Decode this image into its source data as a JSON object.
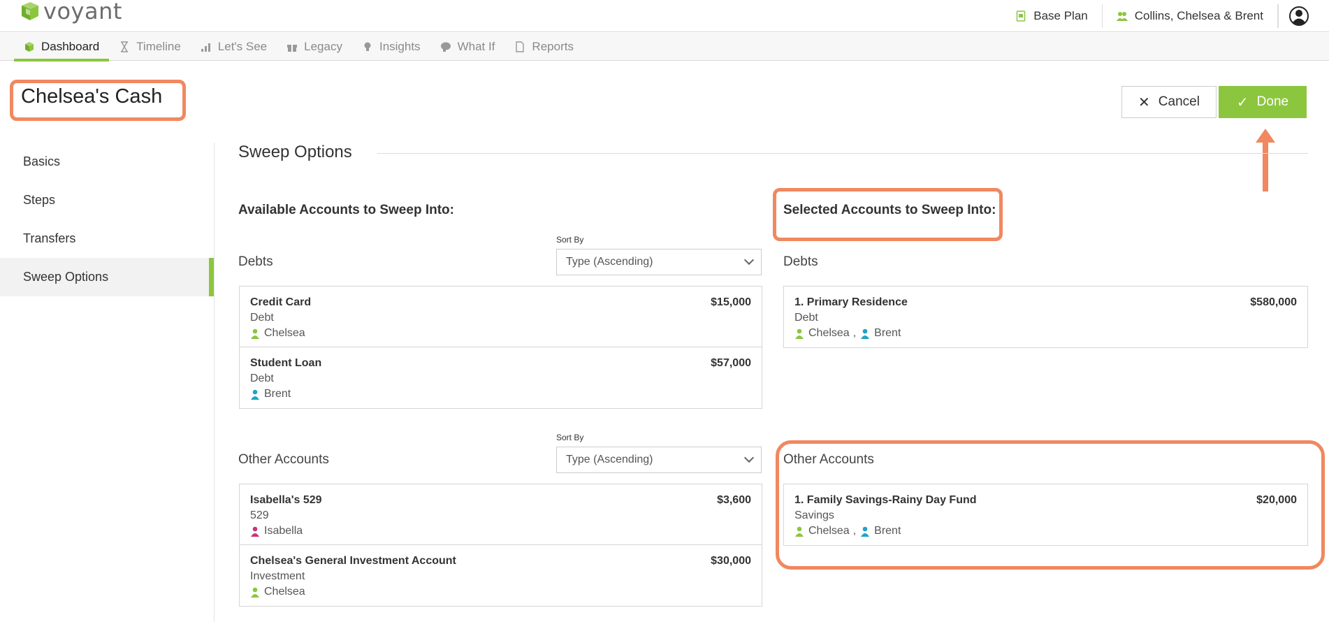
{
  "brand": {
    "name": "voyant",
    "green": "#8cc63f",
    "highlight": "#f08860"
  },
  "header": {
    "plan_label": "Base Plan",
    "clients_label": "Collins, Chelsea & Brent",
    "plan_icon": "document-icon",
    "clients_icon": "people-icon",
    "account_icon": "user-circle-icon"
  },
  "nav": {
    "items": [
      {
        "label": "Dashboard",
        "icon": "cube-icon",
        "active": true
      },
      {
        "label": "Timeline",
        "icon": "hourglass-icon"
      },
      {
        "label": "Let's See",
        "icon": "bar-chart-icon"
      },
      {
        "label": "Legacy",
        "icon": "gift-icon"
      },
      {
        "label": "Insights",
        "icon": "lightbulb-icon"
      },
      {
        "label": "What If",
        "icon": "brain-icon"
      },
      {
        "label": "Reports",
        "icon": "pdf-icon"
      }
    ]
  },
  "page": {
    "title": "Chelsea's Cash",
    "cancel_label": "Cancel",
    "done_label": "Done"
  },
  "sidebar": {
    "items": [
      {
        "label": "Basics"
      },
      {
        "label": "Steps"
      },
      {
        "label": "Transfers"
      },
      {
        "label": "Sweep Options",
        "active": true
      }
    ]
  },
  "sweep": {
    "section_title": "Sweep Options",
    "available_heading": "Available Accounts to Sweep Into:",
    "selected_heading": "Selected Accounts to Sweep Into:",
    "sort_by_label": "Sort By",
    "sort_value": "Type (Ascending)",
    "debts_label": "Debts",
    "other_label": "Other Accounts",
    "available_debts": [
      {
        "name": "Credit Card",
        "type": "Debt",
        "owners": [
          "Chelsea"
        ],
        "amount": "$15,000"
      },
      {
        "name": "Student Loan",
        "type": "Debt",
        "owners": [
          "Brent"
        ],
        "amount": "$57,000"
      }
    ],
    "available_other": [
      {
        "name": "Isabella's 529",
        "type": "529",
        "owners": [
          "Isabella"
        ],
        "amount": "$3,600"
      },
      {
        "name": "Chelsea's General Investment Account",
        "type": "Investment",
        "owners": [
          "Chelsea"
        ],
        "amount": "$30,000"
      }
    ],
    "selected_debts": [
      {
        "name": "1. Primary Residence",
        "type": "Debt",
        "owners": [
          "Chelsea",
          "Brent"
        ],
        "amount": "$580,000"
      }
    ],
    "selected_other": [
      {
        "name": "1. Family Savings-Rainy Day Fund",
        "type": "Savings",
        "owners": [
          "Chelsea",
          "Brent"
        ],
        "amount": "$20,000"
      }
    ],
    "owner_colors": {
      "Chelsea": "#8cc63f",
      "Brent": "#1ea3c8",
      "Isabella": "#c8347a"
    }
  }
}
